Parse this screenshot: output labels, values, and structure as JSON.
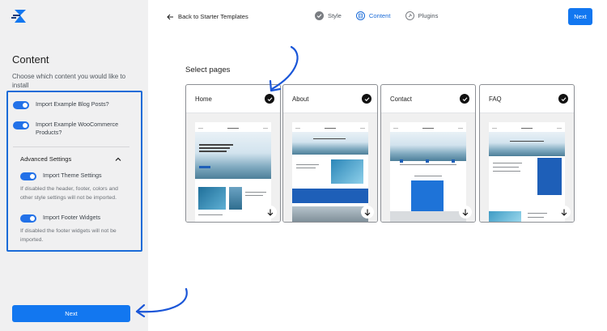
{
  "sidebar": {
    "logo": "starter-templates-logo",
    "title": "Content",
    "description": "Choose which content you would like to install",
    "toggles": [
      {
        "label": "Import Example Blog Posts?",
        "on": true
      },
      {
        "label": "Import Example WooCommerce Products?",
        "on": true
      }
    ],
    "advanced": {
      "title": "Advanced Settings",
      "items": [
        {
          "label": "Import Theme Settings",
          "on": true,
          "note": "If disabled the header, footer, colors and other style settings will not be imported."
        },
        {
          "label": "Import Footer Widgets",
          "on": true,
          "note": "If disabled the footer widgets will not be imported."
        }
      ]
    },
    "next_label": "Next"
  },
  "header": {
    "back_label": "Back to Starter Templates",
    "steps": [
      {
        "label": "Style",
        "state": "done"
      },
      {
        "label": "Content",
        "state": "active"
      },
      {
        "label": "Plugins",
        "state": "pending"
      }
    ],
    "next_label": "Next"
  },
  "main": {
    "title": "Select pages",
    "pages": [
      {
        "title": "Home",
        "selected": true
      },
      {
        "title": "About",
        "selected": true
      },
      {
        "title": "Contact",
        "selected": true
      },
      {
        "title": "FAQ",
        "selected": true
      }
    ]
  },
  "colors": {
    "accent": "#1277f0",
    "highlight": "#1a6bd8",
    "sidebar_bg": "#f0f0f1"
  }
}
